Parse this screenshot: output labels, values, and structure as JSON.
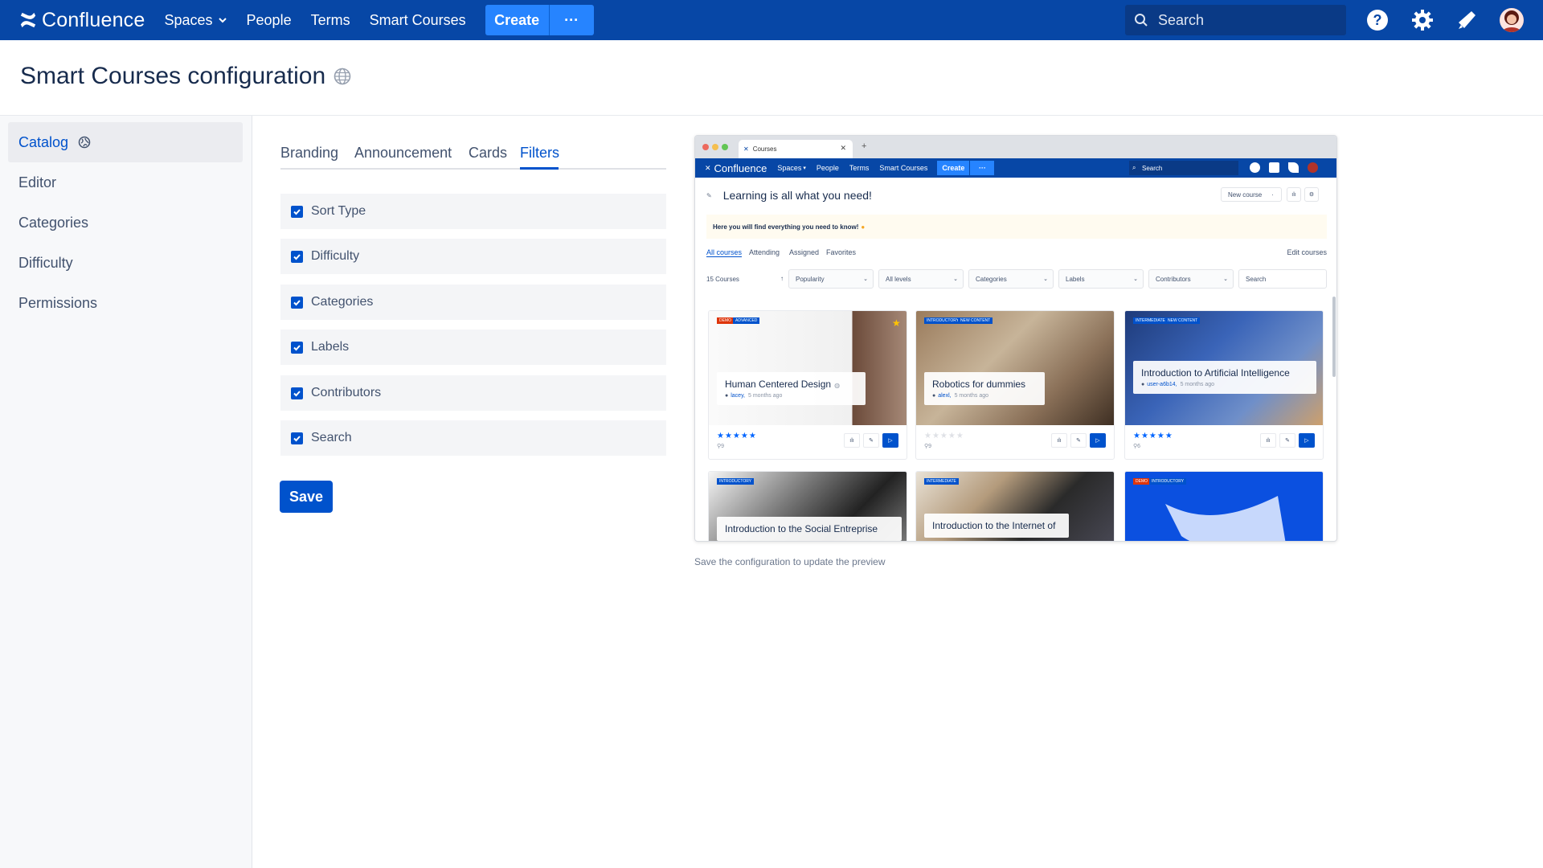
{
  "nav": {
    "logo": "Confluence",
    "spaces": "Spaces",
    "people": "People",
    "terms": "Terms",
    "smart_courses": "Smart Courses",
    "create": "Create",
    "more": "···",
    "search_placeholder": "Search"
  },
  "page": {
    "title": "Smart Courses configuration"
  },
  "sidebar": {
    "items": [
      {
        "label": "Catalog"
      },
      {
        "label": "Editor"
      },
      {
        "label": "Categories"
      },
      {
        "label": "Difficulty"
      },
      {
        "label": "Permissions"
      }
    ]
  },
  "tabs": [
    {
      "label": "Branding"
    },
    {
      "label": "Announcement"
    },
    {
      "label": "Cards"
    },
    {
      "label": "Filters"
    }
  ],
  "filters": [
    {
      "label": "Sort Type",
      "checked": true
    },
    {
      "label": "Difficulty",
      "checked": true
    },
    {
      "label": "Categories",
      "checked": true
    },
    {
      "label": "Labels",
      "checked": true
    },
    {
      "label": "Contributors",
      "checked": true
    },
    {
      "label": "Search",
      "checked": true
    }
  ],
  "save_label": "Save",
  "preview_note": "Save the configuration to update the preview",
  "preview": {
    "browser_tab": "Courses",
    "nav": {
      "logo": "Confluence",
      "spaces": "Spaces",
      "people": "People",
      "terms": "Terms",
      "smart_courses": "Smart Courses",
      "create": "Create",
      "more": "···",
      "search": "Search"
    },
    "title": "Learning is all what you need!",
    "new_course": "New course",
    "announcement": "Here you will find everything you need to know!",
    "tabs": [
      "All courses",
      "Attending",
      "Assigned",
      "Favorites"
    ],
    "edit_courses": "Edit courses",
    "count": "15 Courses",
    "dropdowns": [
      "Popularity",
      "All levels",
      "Categories",
      "Labels",
      "Contributors"
    ],
    "search": "Search",
    "cards": [
      {
        "title": "Human Centered Design",
        "author": "lacey,",
        "ago": "5 months ago",
        "badges": [
          "DEMO",
          "ADVANCED"
        ],
        "count": "9",
        "stars": "★★★★★"
      },
      {
        "title": "Robotics for dummies",
        "author": "alexl,",
        "ago": "5 months ago",
        "badges": [
          "INTRODUCTORY",
          "NEW CONTENT"
        ],
        "count": "9",
        "stars": "★★★★★"
      },
      {
        "title": "Introduction to Artificial Intelligence",
        "author": "user-a6b14,",
        "ago": "5 months ago",
        "badges": [
          "INTERMEDIATE",
          "NEW CONTENT"
        ],
        "count": "6",
        "stars": "★★★★★"
      },
      {
        "title": "Introduction to the Social Entreprise",
        "badges": [
          "INTRODUCTORY"
        ]
      },
      {
        "title": "Introduction to the Internet of",
        "badges": [
          "INTERMEDIATE"
        ]
      },
      {
        "title": "",
        "badges": [
          "DEMO",
          "INTRODUCTORY"
        ]
      }
    ]
  },
  "colors": {
    "nav_bg": "#0747a6",
    "primary": "#0052cc",
    "create_btn": "#2684ff"
  }
}
